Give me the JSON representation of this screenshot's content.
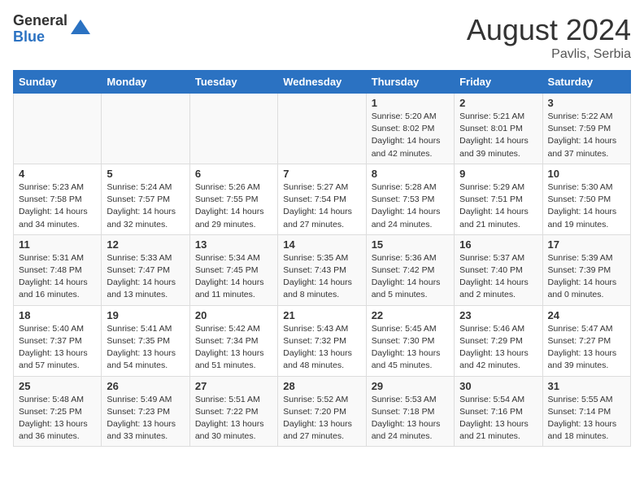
{
  "header": {
    "logo_general": "General",
    "logo_blue": "Blue",
    "month": "August 2024",
    "location": "Pavlis, Serbia"
  },
  "days_of_week": [
    "Sunday",
    "Monday",
    "Tuesday",
    "Wednesday",
    "Thursday",
    "Friday",
    "Saturday"
  ],
  "weeks": [
    [
      {
        "day": "",
        "info": ""
      },
      {
        "day": "",
        "info": ""
      },
      {
        "day": "",
        "info": ""
      },
      {
        "day": "",
        "info": ""
      },
      {
        "day": "1",
        "info": "Sunrise: 5:20 AM\nSunset: 8:02 PM\nDaylight: 14 hours and 42 minutes."
      },
      {
        "day": "2",
        "info": "Sunrise: 5:21 AM\nSunset: 8:01 PM\nDaylight: 14 hours and 39 minutes."
      },
      {
        "day": "3",
        "info": "Sunrise: 5:22 AM\nSunset: 7:59 PM\nDaylight: 14 hours and 37 minutes."
      }
    ],
    [
      {
        "day": "4",
        "info": "Sunrise: 5:23 AM\nSunset: 7:58 PM\nDaylight: 14 hours and 34 minutes."
      },
      {
        "day": "5",
        "info": "Sunrise: 5:24 AM\nSunset: 7:57 PM\nDaylight: 14 hours and 32 minutes."
      },
      {
        "day": "6",
        "info": "Sunrise: 5:26 AM\nSunset: 7:55 PM\nDaylight: 14 hours and 29 minutes."
      },
      {
        "day": "7",
        "info": "Sunrise: 5:27 AM\nSunset: 7:54 PM\nDaylight: 14 hours and 27 minutes."
      },
      {
        "day": "8",
        "info": "Sunrise: 5:28 AM\nSunset: 7:53 PM\nDaylight: 14 hours and 24 minutes."
      },
      {
        "day": "9",
        "info": "Sunrise: 5:29 AM\nSunset: 7:51 PM\nDaylight: 14 hours and 21 minutes."
      },
      {
        "day": "10",
        "info": "Sunrise: 5:30 AM\nSunset: 7:50 PM\nDaylight: 14 hours and 19 minutes."
      }
    ],
    [
      {
        "day": "11",
        "info": "Sunrise: 5:31 AM\nSunset: 7:48 PM\nDaylight: 14 hours and 16 minutes."
      },
      {
        "day": "12",
        "info": "Sunrise: 5:33 AM\nSunset: 7:47 PM\nDaylight: 14 hours and 13 minutes."
      },
      {
        "day": "13",
        "info": "Sunrise: 5:34 AM\nSunset: 7:45 PM\nDaylight: 14 hours and 11 minutes."
      },
      {
        "day": "14",
        "info": "Sunrise: 5:35 AM\nSunset: 7:43 PM\nDaylight: 14 hours and 8 minutes."
      },
      {
        "day": "15",
        "info": "Sunrise: 5:36 AM\nSunset: 7:42 PM\nDaylight: 14 hours and 5 minutes."
      },
      {
        "day": "16",
        "info": "Sunrise: 5:37 AM\nSunset: 7:40 PM\nDaylight: 14 hours and 2 minutes."
      },
      {
        "day": "17",
        "info": "Sunrise: 5:39 AM\nSunset: 7:39 PM\nDaylight: 14 hours and 0 minutes."
      }
    ],
    [
      {
        "day": "18",
        "info": "Sunrise: 5:40 AM\nSunset: 7:37 PM\nDaylight: 13 hours and 57 minutes."
      },
      {
        "day": "19",
        "info": "Sunrise: 5:41 AM\nSunset: 7:35 PM\nDaylight: 13 hours and 54 minutes."
      },
      {
        "day": "20",
        "info": "Sunrise: 5:42 AM\nSunset: 7:34 PM\nDaylight: 13 hours and 51 minutes."
      },
      {
        "day": "21",
        "info": "Sunrise: 5:43 AM\nSunset: 7:32 PM\nDaylight: 13 hours and 48 minutes."
      },
      {
        "day": "22",
        "info": "Sunrise: 5:45 AM\nSunset: 7:30 PM\nDaylight: 13 hours and 45 minutes."
      },
      {
        "day": "23",
        "info": "Sunrise: 5:46 AM\nSunset: 7:29 PM\nDaylight: 13 hours and 42 minutes."
      },
      {
        "day": "24",
        "info": "Sunrise: 5:47 AM\nSunset: 7:27 PM\nDaylight: 13 hours and 39 minutes."
      }
    ],
    [
      {
        "day": "25",
        "info": "Sunrise: 5:48 AM\nSunset: 7:25 PM\nDaylight: 13 hours and 36 minutes."
      },
      {
        "day": "26",
        "info": "Sunrise: 5:49 AM\nSunset: 7:23 PM\nDaylight: 13 hours and 33 minutes."
      },
      {
        "day": "27",
        "info": "Sunrise: 5:51 AM\nSunset: 7:22 PM\nDaylight: 13 hours and 30 minutes."
      },
      {
        "day": "28",
        "info": "Sunrise: 5:52 AM\nSunset: 7:20 PM\nDaylight: 13 hours and 27 minutes."
      },
      {
        "day": "29",
        "info": "Sunrise: 5:53 AM\nSunset: 7:18 PM\nDaylight: 13 hours and 24 minutes."
      },
      {
        "day": "30",
        "info": "Sunrise: 5:54 AM\nSunset: 7:16 PM\nDaylight: 13 hours and 21 minutes."
      },
      {
        "day": "31",
        "info": "Sunrise: 5:55 AM\nSunset: 7:14 PM\nDaylight: 13 hours and 18 minutes."
      }
    ]
  ]
}
